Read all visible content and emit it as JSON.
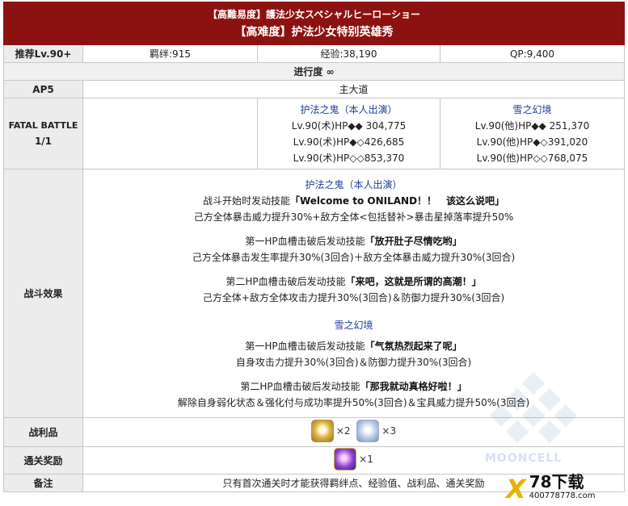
{
  "header": {
    "title_jp": "【高難易度】護法少女スペシャルヒーローショー",
    "title_cn": "【高难度】护法少女特别英雄秀"
  },
  "stats": {
    "label": "推荐Lv.90+",
    "bond": "羁绊:915",
    "exp": "经验:38,190",
    "qp": "QP:9,400"
  },
  "progress": {
    "label": "进行度 ∞"
  },
  "ap": {
    "label": "AP5",
    "value": "主大道"
  },
  "battle": {
    "label": "FATAL BATTLE",
    "wave": "1/1",
    "enemies": [
      {
        "name": "护法之鬼（本人出演）",
        "lines": [
          "Lv.90(术)HP◆◆ 304,775",
          "Lv.90(术)HP◆◇426,685",
          "Lv.90(术)HP◇◇853,370"
        ]
      },
      {
        "name": "雪之幻境",
        "lines": [
          "Lv.90(他)HP◆◆ 251,370",
          "Lv.90(他)HP◆◇391,020",
          "Lv.90(他)HP◇◇768,075"
        ]
      }
    ]
  },
  "effects": {
    "label": "战斗效果",
    "group1": {
      "name": "护法之鬼（本人出演）",
      "s1_pre": "战斗开始时发动技能",
      "s1_skill": "「Welcome to ONILAND！！　该这么说吧」",
      "s1_desc": "己方全体暴击威力提升30%+敌方全体<包括替补>暴击星掉落率提升50%",
      "s2_pre": "第一HP血槽击破后发动技能",
      "s2_skill": "「放开肚子尽情吃哟」",
      "s2_desc": "己方全体暴击发生率提升30%(3回合)＋敌方全体暴击威力提升30%(3回合)",
      "s3_pre": "第二HP血槽击破后发动技能",
      "s3_skill": "「来吧，这就是所谓的高潮！」",
      "s3_desc": "己方全体+敌方全体攻击力提升30%(3回合)＆防御力提升30%(3回合)"
    },
    "group2": {
      "name": "雪之幻境",
      "s1_pre": "第一HP血槽击破后发动技能",
      "s1_skill": "「气氛热烈起来了呢」",
      "s1_desc": "自身攻击力提升30%(3回合)＆防御力提升30%(3回合)",
      "s2_pre": "第二HP血槽击破后发动技能",
      "s2_skill": "「那我就动真格好啦！」",
      "s2_desc": "解除自身弱化状态＆强化付与成功率提升50%(3回合)＆宝具威力提升50%(3回合)"
    }
  },
  "drops": {
    "label": "战利品",
    "item1": "×2",
    "item2": "×3",
    "icon1": "golden-grail-icon",
    "icon2": "crystal-icon"
  },
  "reward": {
    "label": "通关奖励",
    "item": "×1",
    "icon": "saint-quartz-icon"
  },
  "note": {
    "label": "备注",
    "text": "只有首次通关时才能获得羁绊点、经验值、战利品、通关奖励"
  },
  "watermark": {
    "text": "MOONCELL"
  },
  "logo": {
    "mark": "X",
    "big": "78下载",
    "small": "400778778.com"
  },
  "colors": {
    "header_bg": "#8c1212",
    "label_bg": "#ececec",
    "link_blue": "#1d3f9a"
  }
}
